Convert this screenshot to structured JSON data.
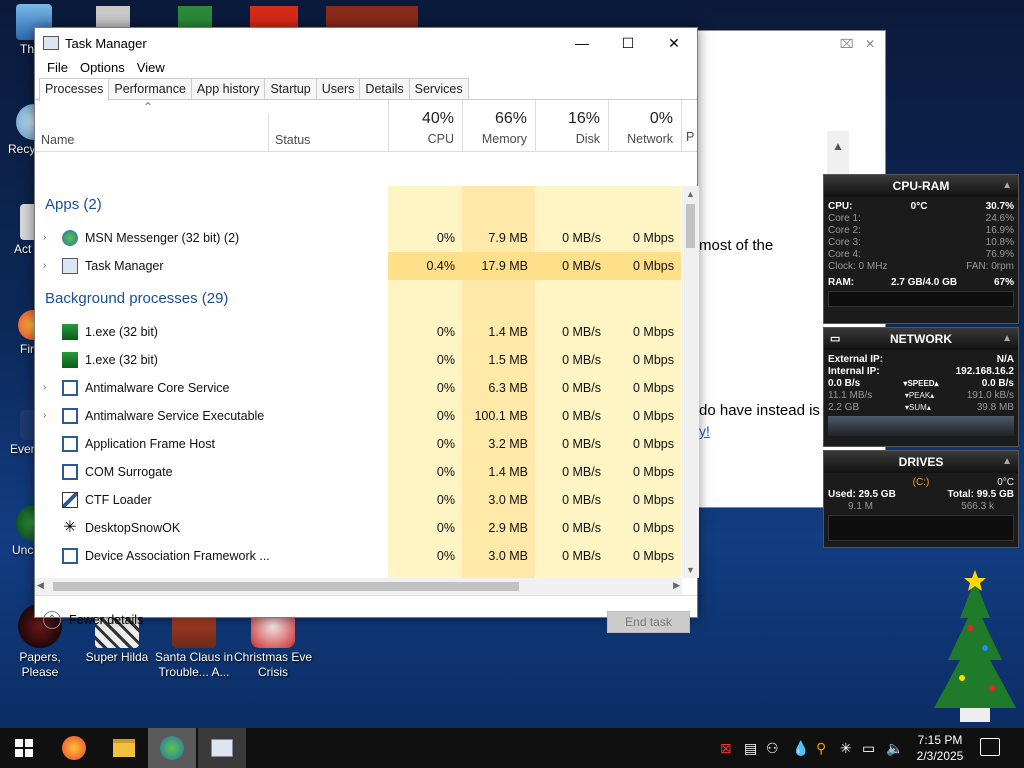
{
  "desktop": {
    "icons": [
      {
        "label": "Th"
      },
      {
        "label": "Recy"
      },
      {
        "label": "Act"
      },
      {
        "label": "Fir"
      },
      {
        "label": "Ever"
      },
      {
        "label": "Unc"
      }
    ],
    "bottom_icons": [
      {
        "label": "Papers, Please"
      },
      {
        "label": "Super Hilda"
      },
      {
        "label": "Santa Claus in Trouble... A..."
      },
      {
        "label": "Christmas Eve Crisis"
      }
    ]
  },
  "background_window": {
    "controls": "⌧ ✕",
    "text1": "most of the",
    "text2": "do have instead is",
    "link": "y!"
  },
  "gadgets": {
    "cpu_ram": {
      "title": "CPU-RAM",
      "cpu_label": "CPU:",
      "temp": "0°C",
      "cpu_pct": "30.7%",
      "cores": [
        {
          "label": "Core 1:",
          "value": "24.6%"
        },
        {
          "label": "Core 2:",
          "value": "16.9%"
        },
        {
          "label": "Core 3:",
          "value": "10.8%"
        },
        {
          "label": "Core 4:",
          "value": "76.9%"
        }
      ],
      "clock": "Clock: 0 MHz",
      "fan": "FAN: 0rpm",
      "ram_label": "RAM:",
      "ram_value": "2.7 GB/4.0 GB",
      "ram_pct": "67%"
    },
    "network": {
      "title": "NETWORK",
      "external_label": "External IP:",
      "external_value": "N/A",
      "internal_label": "Internal IP:",
      "internal_value": "192.168.16.2",
      "speed_left": "0.0 B/s",
      "speed_label": "▾SPEED▴",
      "speed_right": "0.0 B/s",
      "peak_left": "11.1 MB/s",
      "peak_label": "▾PEAK▴",
      "peak_right": "191.0 kB/s",
      "sum_left": "2.2 GB",
      "sum_label": "▾SUM▴",
      "sum_right": "39.8 MB"
    },
    "drives": {
      "title": "DRIVES",
      "drive": "(C:)",
      "temp": "0°C",
      "used": "Used: 29.5 GB",
      "total": "Total: 99.5 GB",
      "read": "9.1 M",
      "write": "566.3 k"
    }
  },
  "taskmgr": {
    "title": "Task Manager",
    "menu": [
      "File",
      "Options",
      "View"
    ],
    "tabs": [
      "Processes",
      "Performance",
      "App history",
      "Startup",
      "Users",
      "Details",
      "Services"
    ],
    "header": {
      "name": "Name",
      "status": "Status",
      "cpu_pct": "40%",
      "cpu": "CPU",
      "mem_pct": "66%",
      "mem": "Memory",
      "disk_pct": "16%",
      "disk": "Disk",
      "net_pct": "0%",
      "net": "Network",
      "p": "P"
    },
    "apps_group": "Apps (2)",
    "bg_group": "Background processes (29)",
    "apps": [
      {
        "name": "MSN Messenger (32 bit) (2)",
        "cpu": "0%",
        "mem": "7.9 MB",
        "disk": "0 MB/s",
        "net": "0 Mbps"
      },
      {
        "name": "Task Manager",
        "cpu": "0.4%",
        "mem": "17.9 MB",
        "disk": "0 MB/s",
        "net": "0 Mbps"
      }
    ],
    "bg": [
      {
        "name": "1.exe (32 bit)",
        "cpu": "0%",
        "mem": "1.4 MB",
        "disk": "0 MB/s",
        "net": "0 Mbps"
      },
      {
        "name": "1.exe (32 bit)",
        "cpu": "0%",
        "mem": "1.5 MB",
        "disk": "0 MB/s",
        "net": "0 Mbps"
      },
      {
        "name": "Antimalware Core Service",
        "cpu": "0%",
        "mem": "6.3 MB",
        "disk": "0 MB/s",
        "net": "0 Mbps"
      },
      {
        "name": "Antimalware Service Executable",
        "cpu": "0%",
        "mem": "100.1 MB",
        "disk": "0 MB/s",
        "net": "0 Mbps"
      },
      {
        "name": "Application Frame Host",
        "cpu": "0%",
        "mem": "3.2 MB",
        "disk": "0 MB/s",
        "net": "0 Mbps"
      },
      {
        "name": "COM Surrogate",
        "cpu": "0%",
        "mem": "1.4 MB",
        "disk": "0 MB/s",
        "net": "0 Mbps"
      },
      {
        "name": "CTF Loader",
        "cpu": "0%",
        "mem": "3.0 MB",
        "disk": "0 MB/s",
        "net": "0 Mbps"
      },
      {
        "name": "DesktopSnowOK",
        "cpu": "0%",
        "mem": "2.9 MB",
        "disk": "0 MB/s",
        "net": "0 Mbps"
      },
      {
        "name": "Device Association Framework ...",
        "cpu": "0%",
        "mem": "3.0 MB",
        "disk": "0 MB/s",
        "net": "0 Mbps"
      }
    ],
    "fewer_details": "Fewer details",
    "end_task": "End task"
  },
  "taskbar": {
    "time": "7:15 PM",
    "date": "2/3/2025"
  },
  "colors": {
    "cpu_col": "#fff4c4",
    "mem_col": "#ffe9a8",
    "highlight": "#1a4f9a"
  }
}
